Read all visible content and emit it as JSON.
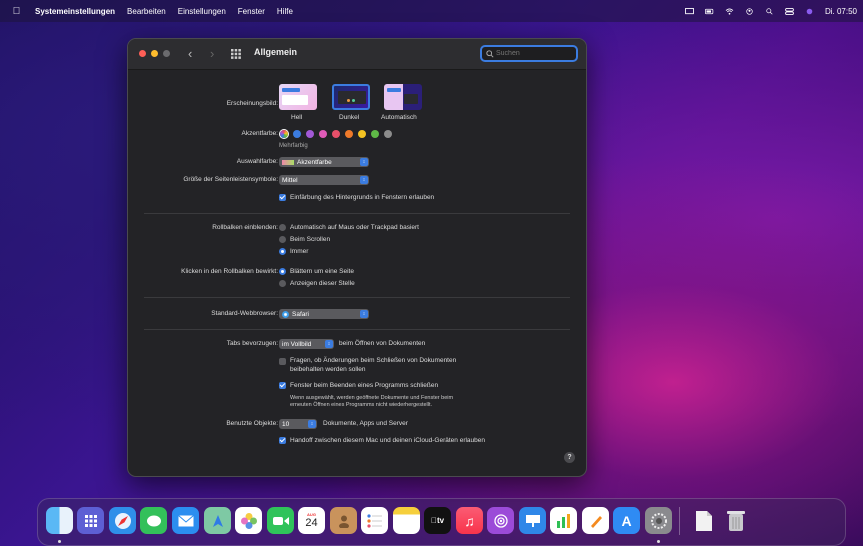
{
  "menubar": {
    "app": "Systemeinstellungen",
    "items": [
      "Bearbeiten",
      "Einstellungen",
      "Fenster",
      "Hilfe"
    ],
    "clock": "Di. 07:50"
  },
  "window": {
    "title": "Allgemein",
    "search_placeholder": "Suchen"
  },
  "appearance": {
    "label": "Erscheinungsbild:",
    "options": [
      "Hell",
      "Dunkel",
      "Automatisch"
    ],
    "selected": "Dunkel"
  },
  "accent": {
    "label": "Akzentfarbe:",
    "caption": "Mehrfarbig",
    "colors": [
      "#3b7ce0",
      "#a259d6",
      "#e05bb8",
      "#e8506a",
      "#ef7a2a",
      "#f4c322",
      "#5fb947",
      "#8c8c8c"
    ]
  },
  "highlight": {
    "label": "Auswahlfarbe:",
    "value": "Akzentfarbe"
  },
  "sidebar_icon_size": {
    "label": "Größe der Seitenleistensymbole:",
    "value": "Mittel"
  },
  "wallpaper_tinting": {
    "label": "Einfärbung des Hintergrunds in Fenstern erlauben",
    "checked": true
  },
  "scrollbars": {
    "label": "Rollbalken einblenden:",
    "options": [
      "Automatisch auf Maus oder Trackpad basiert",
      "Beim Scrollen",
      "Immer"
    ],
    "selected": "Immer"
  },
  "scroll_click": {
    "label": "Klicken in den Rollbalken bewirkt:",
    "options": [
      "Blättern um eine Seite",
      "Anzeigen dieser Stelle"
    ],
    "selected": "Blättern um eine Seite"
  },
  "browser": {
    "label": "Standard-Webbrowser:",
    "value": "Safari"
  },
  "tabs": {
    "label": "Tabs bevorzugen:",
    "value": "im Vollbild",
    "suffix": "beim Öffnen von Dokumenten"
  },
  "ask_keep_changes": {
    "line1": "Fragen, ob Änderungen beim Schließen von Dokumenten",
    "line2": "beibehalten werden sollen",
    "checked": false
  },
  "close_windows": {
    "label": "Fenster beim Beenden eines Programms schließen",
    "note1": "Wenn ausgewählt, werden geöffnete Dokumente und Fenster beim",
    "note2": "erneuten Öffnen eines Programms nicht wiederhergestellt.",
    "checked": true
  },
  "recent_items": {
    "label": "Benutzte Objekte:",
    "value": "10",
    "suffix": "Dokumente, Apps und Server"
  },
  "handoff": {
    "label": "Handoff zwischen diesem Mac und deinen iCloud-Geräten erlauben",
    "checked": true
  },
  "help_symbol": "?",
  "calendar": {
    "month": "AUG",
    "day": "24"
  },
  "tv_label": "tv",
  "dock_icons": [
    "finder-icon",
    "launchpad-icon",
    "safari-icon",
    "messages-icon",
    "mail-icon",
    "maps-icon",
    "photos-icon",
    "facetime-icon",
    "calendar-icon",
    "contacts-icon",
    "reminders-icon",
    "notes-icon",
    "tv-icon",
    "music-icon",
    "podcasts-icon",
    "keynote-icon",
    "numbers-icon",
    "pages-icon",
    "app-store-icon",
    "system-preferences-icon",
    "document-icon",
    "trash-icon"
  ]
}
